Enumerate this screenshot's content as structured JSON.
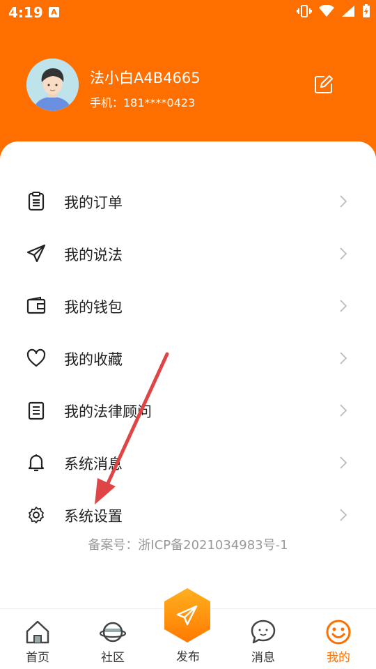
{
  "status_bar": {
    "time": "4:19",
    "notification_icon": "A",
    "icons": [
      "vibrate-icon",
      "wifi-icon",
      "signal-icon",
      "battery-charging-icon"
    ]
  },
  "profile": {
    "username": "法小白A4B4665",
    "phone": "手机：181****0423",
    "edit_icon": "edit-icon"
  },
  "menu": {
    "items": [
      {
        "label": "我的订单",
        "icon": "clipboard-icon"
      },
      {
        "label": "我的说法",
        "icon": "paper-plane-icon"
      },
      {
        "label": "我的钱包",
        "icon": "wallet-icon"
      },
      {
        "label": "我的收藏",
        "icon": "heart-icon"
      },
      {
        "label": "我的法律顾问",
        "icon": "document-list-icon"
      },
      {
        "label": "系统消息",
        "icon": "bell-icon"
      },
      {
        "label": "系统设置",
        "icon": "gear-icon"
      }
    ]
  },
  "icp": "备案号：浙ICP备2021034983号-1",
  "tabbar": {
    "tabs": [
      {
        "label": "首页",
        "icon": "home-icon"
      },
      {
        "label": "社区",
        "icon": "planet-icon"
      },
      {
        "label": "发布",
        "icon": "publish-plane-icon"
      },
      {
        "label": "消息",
        "icon": "chat-bubble-icon"
      },
      {
        "label": "我的",
        "icon": "smiley-icon",
        "active": true
      }
    ]
  },
  "colors": {
    "brand": "#ff6f00",
    "annotation_arrow": "#e04545"
  }
}
